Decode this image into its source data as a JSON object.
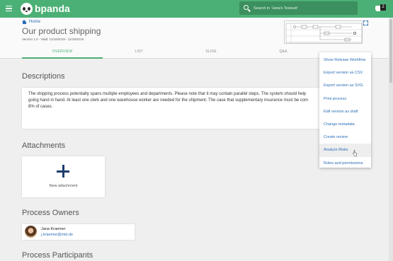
{
  "app": {
    "name": "bpanda"
  },
  "search": {
    "placeholder": "Search in 'Jana's Testsuit'"
  },
  "notifications": {
    "count": "2"
  },
  "breadcrumb": {
    "home": "Home"
  },
  "process": {
    "title": "Our product shipping",
    "version": "Version 1.0 - Valid: 11/18/2019 - 11/18/2019"
  },
  "tabs": [
    {
      "label": "OVERVIEW",
      "active": true
    },
    {
      "label": "LIST"
    },
    {
      "label": "SLIDE"
    },
    {
      "label": "Q&A"
    }
  ],
  "sections": {
    "descriptions": "Descriptions",
    "attachments": "Attachments",
    "owners": "Process Owners",
    "participants": "Process Participants"
  },
  "description_lines": [
    "The shipping process potentially spans multiple employees and departments. Please note that it may contain parallel steps. The system should help",
    "going hand in hand. At least one clerk and one warehouse worker are needed for the shipment. The case that supplementary insurance must be com",
    "8% of cases."
  ],
  "attachment": {
    "label": "New attachment"
  },
  "owner": {
    "name": "Jana Kraemer",
    "email": "j.kraemer@mid.de"
  },
  "menu": {
    "items": [
      "Show Release Workflow",
      "Export version as CSV",
      "Export version as SVG",
      "Print process",
      "Edit version as draft",
      "Change metadata",
      "Create review",
      "Analyze Risks",
      "Roles and permissions"
    ],
    "hovered": "Analyze Risks"
  },
  "colors": {
    "brand": "#4bb075",
    "link": "#2b6fb7",
    "search_bg": "#3c8f5f"
  },
  "icons": [
    "menu-icon",
    "panda-logo-icon",
    "search-icon",
    "notification-icon",
    "home-icon",
    "expand-icon",
    "plus-icon",
    "avatar"
  ]
}
